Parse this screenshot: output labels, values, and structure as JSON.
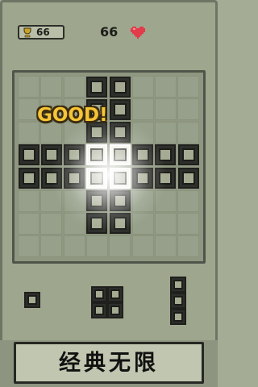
{
  "header": {
    "best_score": "66",
    "score": "66",
    "icons": {
      "trophy": "trophy-icon",
      "heart": "heart-icon"
    }
  },
  "board": {
    "rows": 8,
    "cols": 8,
    "filled_cells": [
      [
        0,
        3
      ],
      [
        0,
        4
      ],
      [
        1,
        3
      ],
      [
        1,
        4
      ],
      [
        2,
        3
      ],
      [
        2,
        4
      ],
      [
        3,
        0
      ],
      [
        3,
        1
      ],
      [
        3,
        2
      ],
      [
        3,
        3
      ],
      [
        3,
        4
      ],
      [
        3,
        5
      ],
      [
        3,
        6
      ],
      [
        3,
        7
      ],
      [
        4,
        0
      ],
      [
        4,
        1
      ],
      [
        4,
        2
      ],
      [
        4,
        3
      ],
      [
        4,
        4
      ],
      [
        4,
        5
      ],
      [
        4,
        6
      ],
      [
        4,
        7
      ],
      [
        5,
        3
      ],
      [
        5,
        4
      ],
      [
        6,
        3
      ],
      [
        6,
        4
      ]
    ],
    "highlighted_cells": [
      [
        3,
        3
      ],
      [
        3,
        4
      ],
      [
        4,
        3
      ],
      [
        4,
        4
      ]
    ]
  },
  "effect": {
    "text": "GOOD!"
  },
  "tray": {
    "pieces": [
      {
        "name": "single",
        "cells": [
          [
            0,
            0
          ]
        ]
      },
      {
        "name": "square-2x2",
        "cells": [
          [
            0,
            0
          ],
          [
            0,
            1
          ],
          [
            1,
            0
          ],
          [
            1,
            1
          ]
        ]
      },
      {
        "name": "vertical-3",
        "cells": [
          [
            0,
            0
          ],
          [
            1,
            0
          ],
          [
            2,
            0
          ]
        ]
      }
    ]
  },
  "footer": {
    "mode_label": "经典无限"
  },
  "colors": {
    "background": "#a5ac95",
    "block_dark": "#2d2f2a",
    "good_text": "#f7c436",
    "heart": "#e23b4a"
  }
}
